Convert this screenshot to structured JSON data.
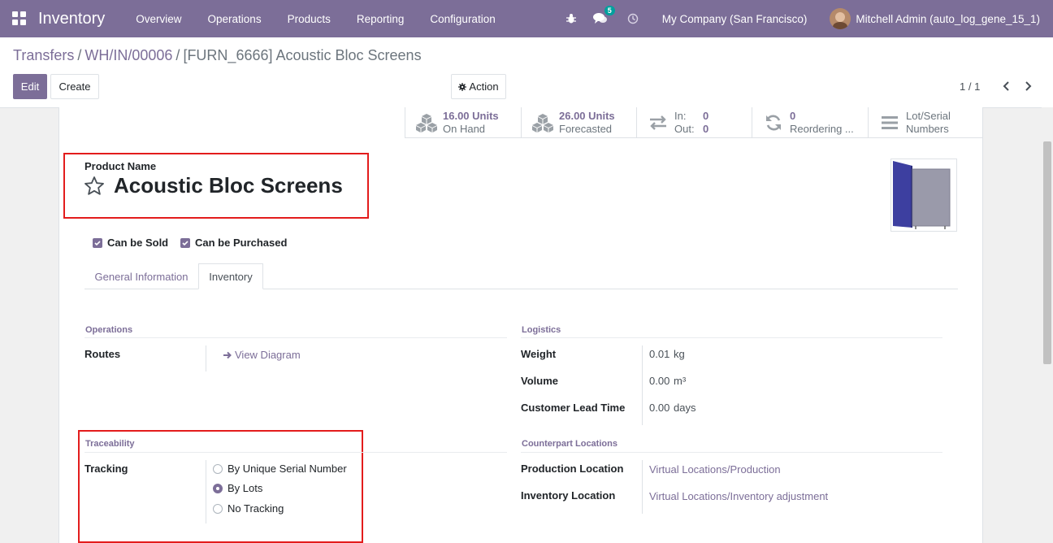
{
  "navbar": {
    "app_title": "Inventory",
    "menu": [
      "Overview",
      "Operations",
      "Products",
      "Reporting",
      "Configuration"
    ],
    "chat_badge": "5",
    "company": "My Company (San Francisco)",
    "user": "Mitchell Admin (auto_log_gene_15_1)"
  },
  "breadcrumb": {
    "items": [
      "Transfers",
      "WH/IN/00006"
    ],
    "sep": "/",
    "current": "[FURN_6666] Acoustic Bloc Screens"
  },
  "buttons": {
    "edit": "Edit",
    "create": "Create",
    "action": "Action"
  },
  "pager": {
    "text": "1 / 1"
  },
  "smart_buttons": {
    "on_hand": {
      "value": "16.00 Units",
      "label": "On Hand",
      "icon": "cubes-icon"
    },
    "forecasted": {
      "value": "26.00 Units",
      "label": "Forecasted",
      "icon": "cubes-icon"
    },
    "in_out": {
      "in_label": "In:",
      "in_value": "0",
      "out_label": "Out:",
      "out_value": "0",
      "icon": "exchange-icon"
    },
    "reordering": {
      "value": "0",
      "label": "Reordering ...",
      "icon": "refresh-icon"
    },
    "lots": {
      "line1": "Lot/Serial",
      "line2": "Numbers",
      "icon": "bars-icon"
    }
  },
  "product": {
    "name_label": "Product Name",
    "name": "Acoustic Bloc Screens",
    "can_be_sold": "Can be Sold",
    "can_be_purchased": "Can be Purchased"
  },
  "tabs": {
    "general": "General Information",
    "inventory": "Inventory"
  },
  "operations": {
    "title": "Operations",
    "routes_label": "Routes",
    "view_diagram": "View Diagram"
  },
  "logistics": {
    "title": "Logistics",
    "weight_label": "Weight",
    "weight_value": "0.01",
    "weight_unit": "kg",
    "volume_label": "Volume",
    "volume_value": "0.00",
    "volume_unit": "m³",
    "lead_label": "Customer Lead Time",
    "lead_value": "0.00",
    "lead_unit": "days"
  },
  "traceability": {
    "title": "Traceability",
    "tracking_label": "Tracking",
    "options": [
      "By Unique Serial Number",
      "By Lots",
      "No Tracking"
    ],
    "selected_index": 1
  },
  "counterpart": {
    "title": "Counterpart Locations",
    "production_label": "Production Location",
    "production_value": "Virtual Locations/Production",
    "inventory_label": "Inventory Location",
    "inventory_value": "Virtual Locations/Inventory adjustment"
  },
  "colors": {
    "brand": "#7c6e98",
    "highlight": "#e31c1c"
  }
}
